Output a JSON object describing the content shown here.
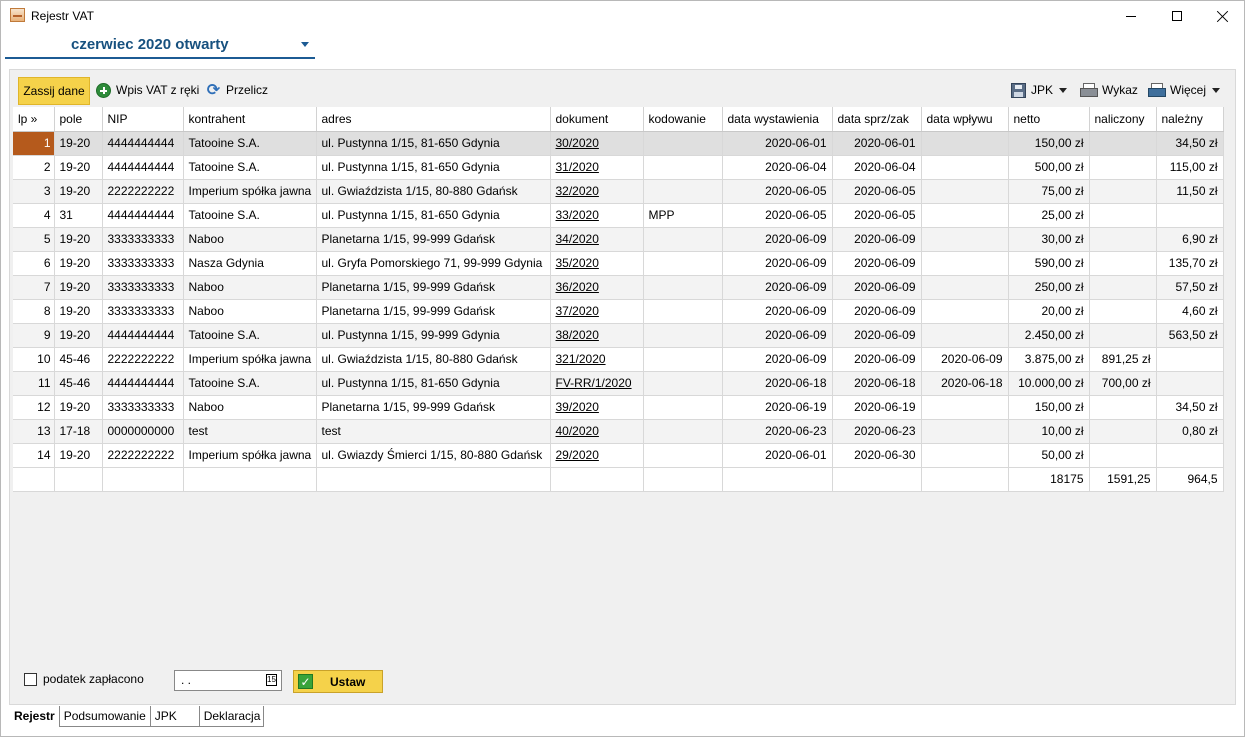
{
  "window": {
    "title": "Rejestr VAT"
  },
  "period": {
    "label": "czerwiec 2020 otwarty"
  },
  "toolbar": {
    "zassij": "Zassij dane",
    "wpis": "Wpis VAT z ręki",
    "przelicz": "Przelicz",
    "jpk": "JPK",
    "wykaz": "Wykaz",
    "wiecej": "Więcej"
  },
  "columns": [
    "lp »",
    "pole",
    "NIP",
    "kontrahent",
    "adres",
    "dokument",
    "kodowanie",
    "data wystawienia",
    "data sprz/zak",
    "data wpływu",
    "netto",
    "naliczony",
    "należny"
  ],
  "rows": [
    [
      "1",
      "19-20",
      "4444444444",
      "Tatooine S.A.",
      "ul. Pustynna 1/15, 81-650 Gdynia",
      "30/2020",
      "",
      "2020-06-01",
      "2020-06-01",
      "",
      "150,00 zł",
      "",
      "34,50 zł"
    ],
    [
      "2",
      "19-20",
      "4444444444",
      "Tatooine S.A.",
      "ul. Pustynna 1/15, 81-650 Gdynia",
      "31/2020",
      "",
      "2020-06-04",
      "2020-06-04",
      "",
      "500,00 zł",
      "",
      "115,00 zł"
    ],
    [
      "3",
      "19-20",
      "2222222222",
      "Imperium spółka jawna",
      "ul. Gwiaździsta 1/15, 80-880 Gdańsk",
      "32/2020",
      "",
      "2020-06-05",
      "2020-06-05",
      "",
      "75,00 zł",
      "",
      "11,50 zł"
    ],
    [
      "4",
      "31",
      "4444444444",
      "Tatooine S.A.",
      "ul. Pustynna 1/15, 81-650 Gdynia",
      "33/2020",
      "MPP",
      "2020-06-05",
      "2020-06-05",
      "",
      "25,00 zł",
      "",
      ""
    ],
    [
      "5",
      "19-20",
      "3333333333",
      "Naboo",
      "Planetarna 1/15, 99-999 Gdańsk",
      "34/2020",
      "",
      "2020-06-09",
      "2020-06-09",
      "",
      "30,00 zł",
      "",
      "6,90 zł"
    ],
    [
      "6",
      "19-20",
      "3333333333",
      "Nasza Gdynia",
      "ul. Gryfa Pomorskiego 71, 99-999 Gdynia",
      "35/2020",
      "",
      "2020-06-09",
      "2020-06-09",
      "",
      "590,00 zł",
      "",
      "135,70 zł"
    ],
    [
      "7",
      "19-20",
      "3333333333",
      "Naboo",
      "Planetarna 1/15, 99-999 Gdańsk",
      "36/2020",
      "",
      "2020-06-09",
      "2020-06-09",
      "",
      "250,00 zł",
      "",
      "57,50 zł"
    ],
    [
      "8",
      "19-20",
      "3333333333",
      "Naboo",
      "Planetarna 1/15, 99-999 Gdańsk",
      "37/2020",
      "",
      "2020-06-09",
      "2020-06-09",
      "",
      "20,00 zł",
      "",
      "4,60 zł"
    ],
    [
      "9",
      "19-20",
      "4444444444",
      "Tatooine S.A.",
      "ul. Pustynna 1/15, 99-999 Gdynia",
      "38/2020",
      "",
      "2020-06-09",
      "2020-06-09",
      "",
      "2.450,00 zł",
      "",
      "563,50 zł"
    ],
    [
      "10",
      "45-46",
      "2222222222",
      "Imperium spółka jawna",
      "ul. Gwiaździsta 1/15, 80-880 Gdańsk",
      "321/2020",
      "",
      "2020-06-09",
      "2020-06-09",
      "2020-06-09",
      "3.875,00 zł",
      "891,25 zł",
      ""
    ],
    [
      "11",
      "45-46",
      "4444444444",
      "Tatooine S.A.",
      "ul. Pustynna 1/15, 81-650 Gdynia",
      "FV-RR/1/2020",
      "",
      "2020-06-18",
      "2020-06-18",
      "2020-06-18",
      "10.000,00 zł",
      "700,00 zł",
      ""
    ],
    [
      "12",
      "19-20",
      "3333333333",
      "Naboo",
      "Planetarna 1/15, 99-999 Gdańsk",
      "39/2020",
      "",
      "2020-06-19",
      "2020-06-19",
      "",
      "150,00 zł",
      "",
      "34,50 zł"
    ],
    [
      "13",
      "17-18",
      "0000000000",
      "test",
      "test",
      "40/2020",
      "",
      "2020-06-23",
      "2020-06-23",
      "",
      "10,00 zł",
      "",
      "0,80 zł"
    ],
    [
      "14",
      "19-20",
      "2222222222",
      "Imperium spółka jawna",
      "ul. Gwiazdy Śmierci 1/15, 80-880 Gdańsk",
      "29/2020",
      "",
      "2020-06-01",
      "2020-06-30",
      "",
      "50,00 zł",
      "",
      ""
    ]
  ],
  "totals": {
    "netto": "18175",
    "naliczony": "1591,25",
    "nalezny": "964,5"
  },
  "bottom": {
    "checkbox_label": "podatek zapłacono",
    "date_value": ".  .",
    "calendar_glyph": "15",
    "ustaw": "Ustaw"
  },
  "tabs": [
    "Rejestr",
    "Podsumowanie",
    "JPK",
    "Deklaracja"
  ],
  "colors": {
    "accent_yellow": "#f5d24a",
    "period_blue": "#17517f",
    "selected_marker": "#b55a1c"
  }
}
